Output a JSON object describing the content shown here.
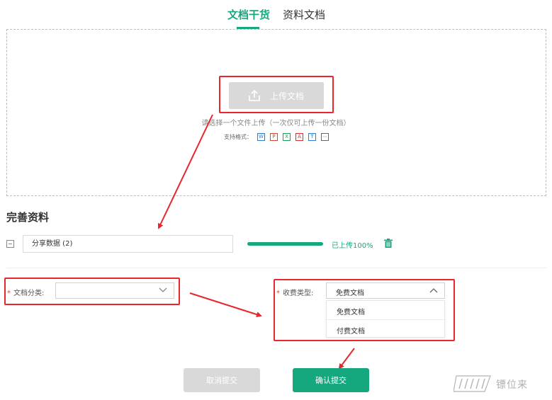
{
  "tabs": [
    {
      "label": "文档干货",
      "active": true
    },
    {
      "label": "资料文档",
      "active": false
    }
  ],
  "upload": {
    "button_label": "上传文档",
    "icon": "upload-icon",
    "hint": "请选择一个文件上传（一次仅可上传一份文档）",
    "formats_label": "支持格式：",
    "formats": [
      {
        "glyph": "W",
        "icon": "word-icon",
        "color": "#2b7cd3"
      },
      {
        "glyph": "P",
        "icon": "powerpoint-icon",
        "color": "#d24726"
      },
      {
        "glyph": "X",
        "icon": "excel-icon",
        "color": "#1e9e50"
      },
      {
        "glyph": "A",
        "icon": "pdf-icon",
        "color": "#e02d2d"
      },
      {
        "glyph": "T",
        "icon": "text-icon",
        "color": "#2b7cd3"
      },
      {
        "glyph": "⋯",
        "icon": "other-format-icon",
        "color": "#666666"
      }
    ]
  },
  "section": {
    "title": "完善资料"
  },
  "file": {
    "name": "分享数据 (2)",
    "progress": 1.0,
    "progress_text": "已上传100%",
    "delete_icon": "trash-icon"
  },
  "form": {
    "category": {
      "required": "*",
      "label": "文档分类:",
      "value": ""
    },
    "fee": {
      "required": "*",
      "label": "收费类型:",
      "value": "免费文档",
      "options": [
        "免费文档",
        "付费文档"
      ]
    }
  },
  "buttons": {
    "cancel": "取消提交",
    "submit": "确认提交"
  },
  "colors": {
    "accent": "#15a87e",
    "annotation": "#e8262d",
    "disabled": "#d9d9d9"
  },
  "watermark": {
    "text": "镖位来"
  }
}
